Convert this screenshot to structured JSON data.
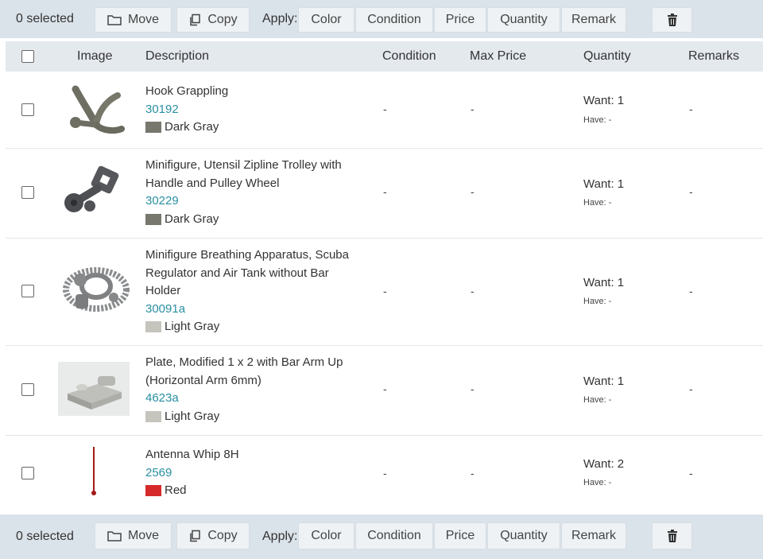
{
  "toolbar": {
    "selected_text": "0 selected",
    "move_label": "Move",
    "copy_label": "Copy",
    "apply_label": "Apply:",
    "apply_buttons": [
      "Color",
      "Condition",
      "Price",
      "Quantity",
      "Remark"
    ]
  },
  "table": {
    "headers": {
      "image": "Image",
      "description": "Description",
      "condition": "Condition",
      "max_price": "Max Price",
      "quantity": "Quantity",
      "remarks": "Remarks"
    },
    "rows": [
      {
        "desc_lines": [
          "Hook Grappling"
        ],
        "part_id": "30192",
        "color_name": "Dark Gray",
        "color_hex": "#77776e",
        "condition": "-",
        "max_price": "-",
        "want": "Want: 1",
        "have": "Have: -",
        "remarks": "-",
        "image_icon": "grappling-hook-image"
      },
      {
        "desc_lines": [
          "Minifigure, Utensil Zipline Trolley with",
          "Handle and Pulley Wheel"
        ],
        "part_id": "30229",
        "color_name": "Dark Gray",
        "color_hex": "#77776e",
        "condition": "-",
        "max_price": "-",
        "want": "Want: 1",
        "have": "Have: -",
        "remarks": "-",
        "image_icon": "zipline-trolley-image"
      },
      {
        "desc_lines": [
          "Minifigure Breathing Apparatus, Scuba",
          "Regulator and Air Tank without Bar",
          "Holder"
        ],
        "part_id": "30091a",
        "color_name": "Light Gray",
        "color_hex": "#c5c4bd",
        "condition": "-",
        "max_price": "-",
        "want": "Want: 1",
        "have": "Have: -",
        "remarks": "-",
        "image_icon": "scuba-regulator-image"
      },
      {
        "desc_lines": [
          "Plate, Modified 1 x 2 with Bar Arm Up",
          "(Horizontal Arm 6mm)"
        ],
        "part_id": "4623a",
        "color_name": "Light Gray",
        "color_hex": "#c5c4bd",
        "condition": "-",
        "max_price": "-",
        "want": "Want: 1",
        "have": "Have: -",
        "remarks": "-",
        "image_icon": "plate-bar-arm-image"
      },
      {
        "desc_lines": [
          "Antenna Whip 8H"
        ],
        "part_id": "2569",
        "color_name": "Red",
        "color_hex": "#d62a2a",
        "condition": "-",
        "max_price": "-",
        "want": "Want: 2",
        "have": "Have: -",
        "remarks": "-",
        "image_icon": "antenna-whip-image"
      }
    ]
  },
  "colors": {
    "toolbar_bg": "#dbe3ea",
    "header_bg": "#e4e9ee",
    "link": "#2a8fa3"
  }
}
